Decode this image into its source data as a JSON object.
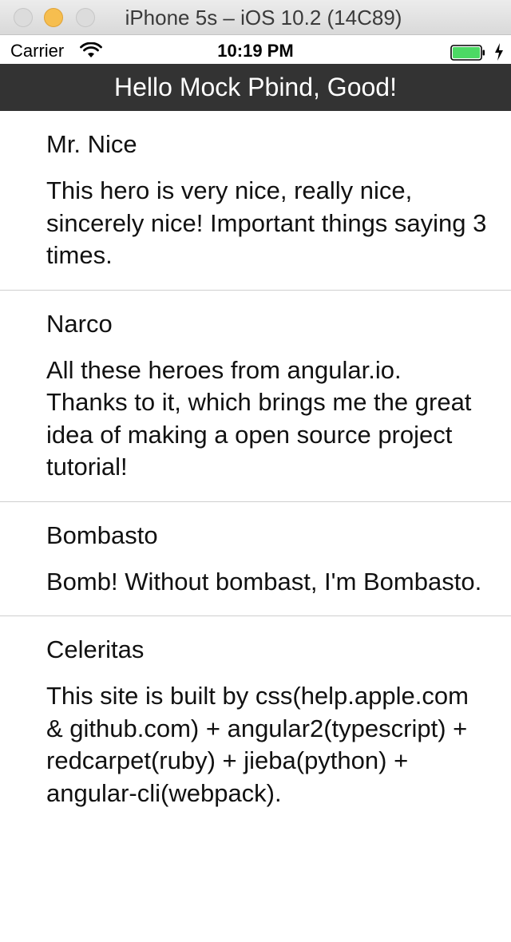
{
  "window": {
    "title": "iPhone 5s – iOS 10.2 (14C89)"
  },
  "status_bar": {
    "carrier": "Carrier",
    "time": "10:19 PM",
    "battery_color": "#4cd964"
  },
  "header": {
    "title": "Hello Mock Pbind, Good!",
    "background": "#333333"
  },
  "heroes": [
    {
      "name": "Mr. Nice",
      "description": "This hero is very nice, really nice, sincerely nice! Important things saying 3 times."
    },
    {
      "name": "Narco",
      "description": "All these heroes from angular.io. Thanks to it, which brings me the great idea of making a open source project tutorial!"
    },
    {
      "name": "Bombasto",
      "description": "Bomb! Without bombast, I'm Bombasto."
    },
    {
      "name": "Celeritas",
      "description": "This site is built by css(help.apple.com & github.com) + angular2(typescript) + redcarpet(ruby) + jieba(python) + angular-cli(webpack)."
    }
  ]
}
